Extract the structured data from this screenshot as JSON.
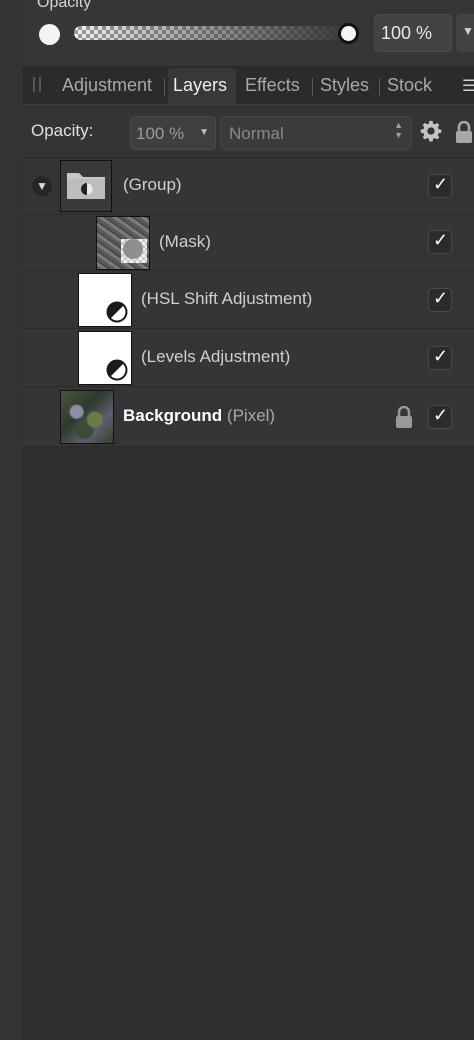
{
  "top": {
    "label": "Opacity",
    "value": "100 %",
    "slider_percent": 100
  },
  "tabs": [
    {
      "label": "Adjustment",
      "active": false
    },
    {
      "label": "Layers",
      "active": true
    },
    {
      "label": "Effects",
      "active": false
    },
    {
      "label": "Styles",
      "active": false
    },
    {
      "label": "Stock",
      "active": false
    }
  ],
  "layer_controls": {
    "opacity_label": "Opacity:",
    "opacity_value": "100 %",
    "blend_mode": "Normal"
  },
  "layers": [
    {
      "name": "(Group)",
      "bold": "",
      "visible": true,
      "expanded": true
    },
    {
      "name": "(Mask)",
      "bold": "",
      "visible": true
    },
    {
      "name": "(HSL Shift Adjustment)",
      "bold": "",
      "visible": true
    },
    {
      "name": "(Levels Adjustment)",
      "bold": "",
      "visible": true
    },
    {
      "name": "(Pixel)",
      "bold": "Background",
      "visible": true,
      "locked": true
    }
  ],
  "icons": {
    "disclosure": "triangle-down",
    "checkbox": "checkmark",
    "settings": "gear",
    "lock": "padlock",
    "menu": "hamburger"
  },
  "colors": {
    "panel_bg": "#2f2f2f",
    "row_bg": "#353535",
    "text": "#cfcfcf",
    "active_tab_text": "#f0f0f0"
  }
}
